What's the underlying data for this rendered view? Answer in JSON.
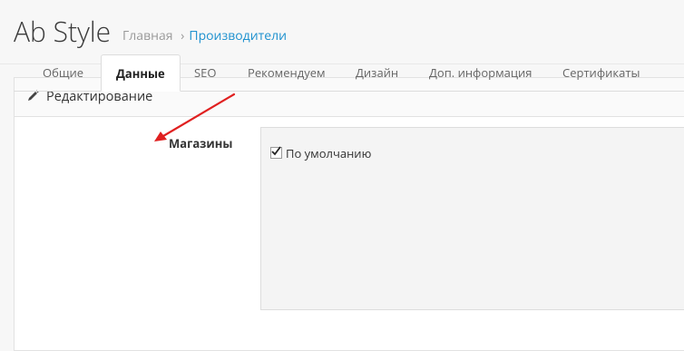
{
  "header": {
    "app_title": "Ab Style",
    "breadcrumb": {
      "home": "Главная",
      "separator": "›",
      "current": "Производители"
    }
  },
  "panel": {
    "title": "Редактирование",
    "tabs": [
      "Общие",
      "Данные",
      "SEO",
      "Рекомендуем",
      "Дизайн",
      "Доп. информация",
      "Сертификаты"
    ],
    "active_tab": "Данные"
  },
  "form": {
    "stores_label": "Магазины",
    "default_store_label": "По умолчанию",
    "default_store_checked": true
  },
  "colors": {
    "accent": "#1e91cf",
    "annotation_arrow": "#e02020"
  }
}
